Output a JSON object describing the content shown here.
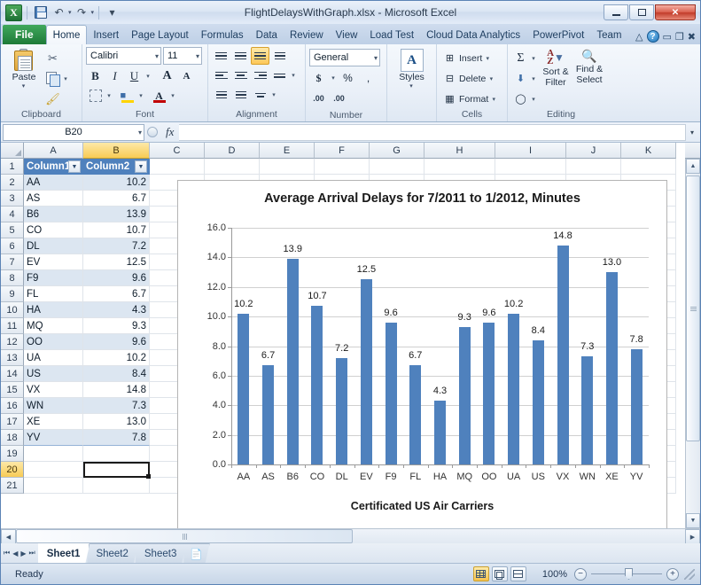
{
  "window": {
    "title": "FlightDelaysWithGraph.xlsx  -  Microsoft Excel",
    "minimize_label": "–",
    "maximize_label": "□",
    "close_label": "✕"
  },
  "quick_access": {
    "logo": "X",
    "items": [
      {
        "name": "save-icon",
        "glyph": ""
      },
      {
        "name": "undo-icon",
        "glyph": "↶"
      },
      {
        "name": "redo-icon",
        "glyph": "↷"
      },
      {
        "name": "customize-qat-icon",
        "glyph": "▾"
      }
    ]
  },
  "ribbon": {
    "file_tab": "File",
    "tabs": [
      {
        "label": "Home",
        "active": true
      },
      {
        "label": "Insert",
        "active": false
      },
      {
        "label": "Page Layout",
        "active": false
      },
      {
        "label": "Formulas",
        "active": false
      },
      {
        "label": "Data",
        "active": false
      },
      {
        "label": "Review",
        "active": false
      },
      {
        "label": "View",
        "active": false
      },
      {
        "label": "Load Test",
        "active": false
      },
      {
        "label": "Cloud Data Analytics",
        "active": false
      },
      {
        "label": "PowerPivot",
        "active": false
      },
      {
        "label": "Team",
        "active": false
      }
    ],
    "right_icons": [
      {
        "name": "minimize-ribbon-icon",
        "glyph": "△"
      },
      {
        "name": "help-icon",
        "glyph": "?"
      },
      {
        "name": "restore-window-icon",
        "glyph": "▭"
      },
      {
        "name": "restore-down-icon",
        "glyph": "❐"
      },
      {
        "name": "close-window-icon",
        "glyph": "✖"
      }
    ],
    "groups": {
      "clipboard": {
        "label": "Clipboard",
        "paste": "Paste",
        "cut": "",
        "copy": "",
        "format_painter": ""
      },
      "font": {
        "label": "Font",
        "font_name": "Calibri",
        "font_size": "11",
        "bold": "B",
        "italic": "I",
        "underline": "U",
        "grow_font": "A",
        "shrink_font": "A"
      },
      "alignment": {
        "label": "Alignment"
      },
      "number": {
        "label": "Number",
        "format": "General",
        "currency": "$",
        "percent": "%",
        "comma": ",",
        "increase_decimal": ".00",
        "decrease_decimal": ".00"
      },
      "styles": {
        "label": "",
        "button": "Styles"
      },
      "cells": {
        "label": "Cells",
        "insert": "Insert",
        "delete": "Delete",
        "format": "Format"
      },
      "editing": {
        "label": "Editing",
        "autosum": "Σ",
        "sort_filter": "Sort &\nFilter",
        "sort_filter_l1": "Sort &",
        "sort_filter_l2": "Filter",
        "find_select_l1": "Find &",
        "find_select_l2": "Select"
      }
    }
  },
  "formula_bar": {
    "name_box": "B20",
    "fx": "fx",
    "formula": ""
  },
  "grid": {
    "column_headers": [
      "A",
      "B",
      "C",
      "D",
      "E",
      "F",
      "G",
      "H",
      "I",
      "J",
      "K"
    ],
    "selected_column": "B",
    "row_headers": [
      "1",
      "2",
      "3",
      "4",
      "5",
      "6",
      "7",
      "8",
      "9",
      "10",
      "11",
      "12",
      "13",
      "14",
      "15",
      "16",
      "17",
      "18",
      "19",
      "20",
      "21"
    ],
    "selected_row": "20",
    "selected_cell": "B20",
    "table_headers": [
      "Column1",
      "Column2"
    ],
    "rows": [
      {
        "a": "AA",
        "b": "10.2"
      },
      {
        "a": "AS",
        "b": "6.7"
      },
      {
        "a": "B6",
        "b": "13.9"
      },
      {
        "a": "CO",
        "b": "10.7"
      },
      {
        "a": "DL",
        "b": "7.2"
      },
      {
        "a": "EV",
        "b": "12.5"
      },
      {
        "a": "F9",
        "b": "9.6"
      },
      {
        "a": "FL",
        "b": "6.7"
      },
      {
        "a": "HA",
        "b": "4.3"
      },
      {
        "a": "MQ",
        "b": "9.3"
      },
      {
        "a": "OO",
        "b": "9.6"
      },
      {
        "a": "UA",
        "b": "10.2"
      },
      {
        "a": "US",
        "b": "8.4"
      },
      {
        "a": "VX",
        "b": "14.8"
      },
      {
        "a": "WN",
        "b": "7.3"
      },
      {
        "a": "XE",
        "b": "13.0"
      },
      {
        "a": "YV",
        "b": "7.8"
      }
    ]
  },
  "chart_data": {
    "type": "bar",
    "title": "Average Arrival Delays for 7/2011 to 1/2012, Minutes",
    "xlabel": "Certificated US Air Carriers",
    "ylabel": "",
    "categories": [
      "AA",
      "AS",
      "B6",
      "CO",
      "DL",
      "EV",
      "F9",
      "FL",
      "HA",
      "MQ",
      "OO",
      "UA",
      "US",
      "VX",
      "WN",
      "XE",
      "YV"
    ],
    "values": [
      10.2,
      6.7,
      13.9,
      10.7,
      7.2,
      12.5,
      9.6,
      6.7,
      4.3,
      9.3,
      9.6,
      10.2,
      8.4,
      14.8,
      7.3,
      13.0,
      7.8
    ],
    "data_labels": [
      "10.2",
      "6.7",
      "13.9",
      "10.7",
      "7.2",
      "12.5",
      "9.6",
      "6.7",
      "4.3",
      "9.3",
      "9.6",
      "10.2",
      "8.4",
      "14.8",
      "7.3",
      "13.0",
      "7.8"
    ],
    "ylim": [
      0,
      16
    ],
    "ytick_labels": [
      "0.0",
      "2.0",
      "4.0",
      "6.0",
      "8.0",
      "10.0",
      "12.0",
      "14.0",
      "16.0"
    ],
    "ytick_values": [
      0,
      2,
      4,
      6,
      8,
      10,
      12,
      14,
      16
    ],
    "grid": true,
    "legend": "none",
    "series_color": "#4F81BD"
  },
  "sheet_tabs": {
    "nav": [
      "⏮",
      "◀",
      "▶",
      "⏭"
    ],
    "tabs": [
      {
        "label": "Sheet1",
        "active": true
      },
      {
        "label": "Sheet2",
        "active": false
      },
      {
        "label": "Sheet3",
        "active": false
      }
    ],
    "new_sheet_icon": "new-sheet-icon"
  },
  "status_bar": {
    "state": "Ready",
    "views": [
      {
        "name": "normal-view-button",
        "active": true
      },
      {
        "name": "page-layout-view-button",
        "active": false
      },
      {
        "name": "page-break-preview-button",
        "active": false
      }
    ],
    "zoom": "100%",
    "zoom_out": "−",
    "zoom_in": "+"
  },
  "colors": {
    "accent": "#4F81BD",
    "table_band": "#DCE6F1",
    "excel_green": "#217346"
  }
}
